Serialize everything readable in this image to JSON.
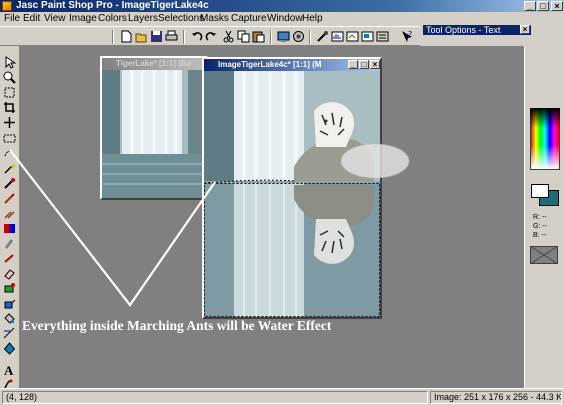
{
  "window": {
    "title": "Jasc Paint Shop Pro - ImageTigerLake4c",
    "min": "_",
    "max": "□",
    "close": "×"
  },
  "menu": [
    "File",
    "Edit",
    "View",
    "Image",
    "Colors",
    "Layers",
    "Selections",
    "Masks",
    "Capture",
    "Window",
    "Help"
  ],
  "tool_options": {
    "title": "Tool Options - Text",
    "close": "×"
  },
  "toolbar_icons": [
    "new-icon",
    "open-icon",
    "save-icon",
    "print-icon",
    "undo-icon",
    "redo-icon",
    "cut-icon",
    "copy-icon",
    "paste-icon",
    "browse-icon",
    "screen-capture-icon",
    "dropper-style-icon",
    "histogram-icon",
    "layers-icon",
    "overview-icon",
    "controls-icon",
    "help-icon"
  ],
  "tools": [
    "arrow-tool",
    "zoom-tool",
    "deformation-tool",
    "crop-tool",
    "mover-tool",
    "selection-tool",
    "magic-wand-tool",
    "dropper-tool",
    "paintbrush-tool",
    "clone-brush-tool",
    "color-replacer-tool",
    "retouch-tool",
    "scratch-remover-tool",
    "eraser-tool",
    "picture-tube-tool",
    "airbrush-tool",
    "flood-fill-tool",
    "text-tool",
    "draw-tool",
    "preset-shapes-tool",
    "object-selector-tool"
  ],
  "doc_back": {
    "title": "TigerLake* [1:1] (Ba",
    "min": "_",
    "max": "□"
  },
  "doc_front": {
    "title": "ImageTigerLake4c* [1:1] (M",
    "min": "_",
    "max": "□",
    "close": "×"
  },
  "color_palette": {
    "r": "R: --",
    "g": "G: --",
    "b": "B: --",
    "fg": "#ffffff",
    "bg": "#1e6b7a"
  },
  "annotation": "Everything inside Marching Ants will be Water Effect",
  "status": {
    "coords": "(4, 128)",
    "image_info": "Image:  251 x 176 x 256 - 44.3 KBytes"
  }
}
